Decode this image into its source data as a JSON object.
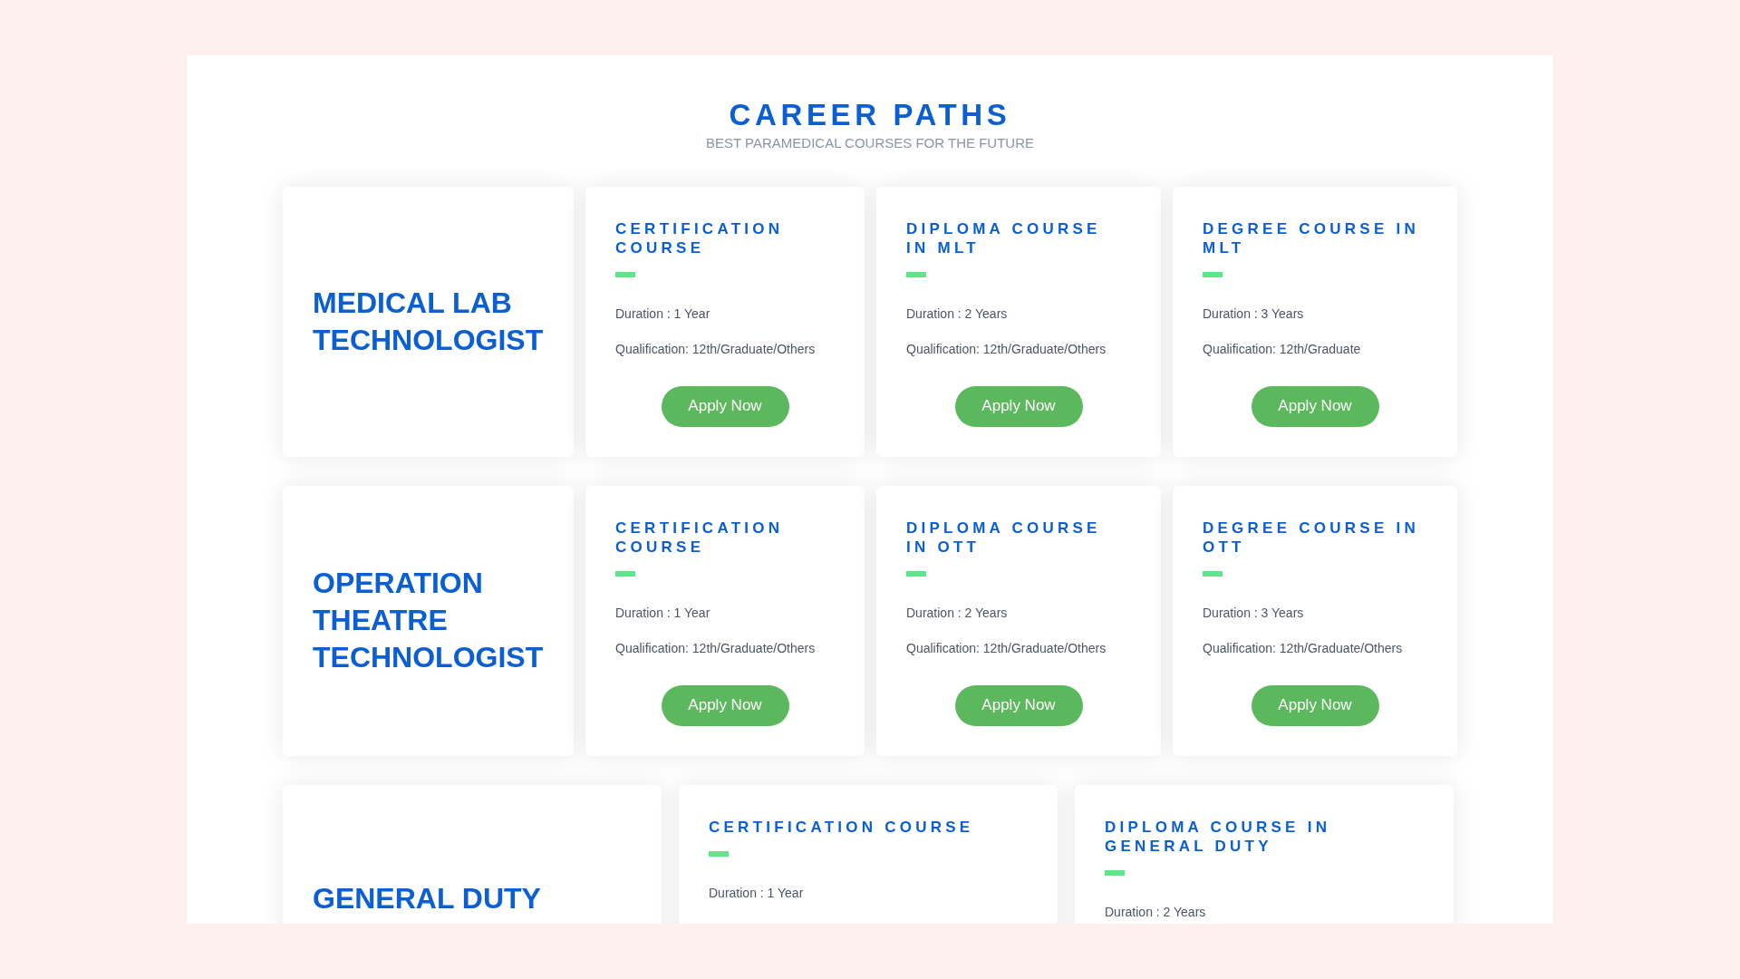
{
  "header": {
    "title": "CAREER PATHS",
    "subtitle": "BEST PARAMEDICAL COURSES FOR THE FUTURE"
  },
  "paths": [
    {
      "name": "MEDICAL LAB TECHNOLOGIST",
      "courses": [
        {
          "title": "CERTIFICATION COURSE",
          "duration": "Duration : 1 Year",
          "qualification": "Qualification: 12th/Graduate/Others",
          "button": "Apply Now"
        },
        {
          "title": "DIPLOMA COURSE IN MLT",
          "duration": "Duration : 2 Years",
          "qualification": "Qualification: 12th/Graduate/Others",
          "button": "Apply Now"
        },
        {
          "title": "DEGREE COURSE IN MLT",
          "duration": "Duration : 3 Years",
          "qualification": "Qualification: 12th/Graduate",
          "button": "Apply Now"
        }
      ]
    },
    {
      "name": "OPERATION THEATRE TECHNOLOGIST",
      "courses": [
        {
          "title": "CERTIFICATION COURSE",
          "duration": "Duration : 1 Year",
          "qualification": "Qualification: 12th/Graduate/Others",
          "button": "Apply Now"
        },
        {
          "title": "DIPLOMA COURSE IN OTT",
          "duration": "Duration : 2 Years",
          "qualification": "Qualification: 12th/Graduate/Others",
          "button": "Apply Now"
        },
        {
          "title": "DEGREE COURSE IN OTT",
          "duration": "Duration : 3 Years",
          "qualification": "Qualification: 12th/Graduate/Others",
          "button": "Apply Now"
        }
      ]
    },
    {
      "name": "GENERAL DUTY",
      "courses": [
        {
          "title": "CERTIFICATION COURSE",
          "duration": "Duration : 1 Year"
        },
        {
          "title": "DIPLOMA COURSE IN GENERAL DUTY",
          "duration": "Duration : 2 Years"
        }
      ]
    }
  ]
}
